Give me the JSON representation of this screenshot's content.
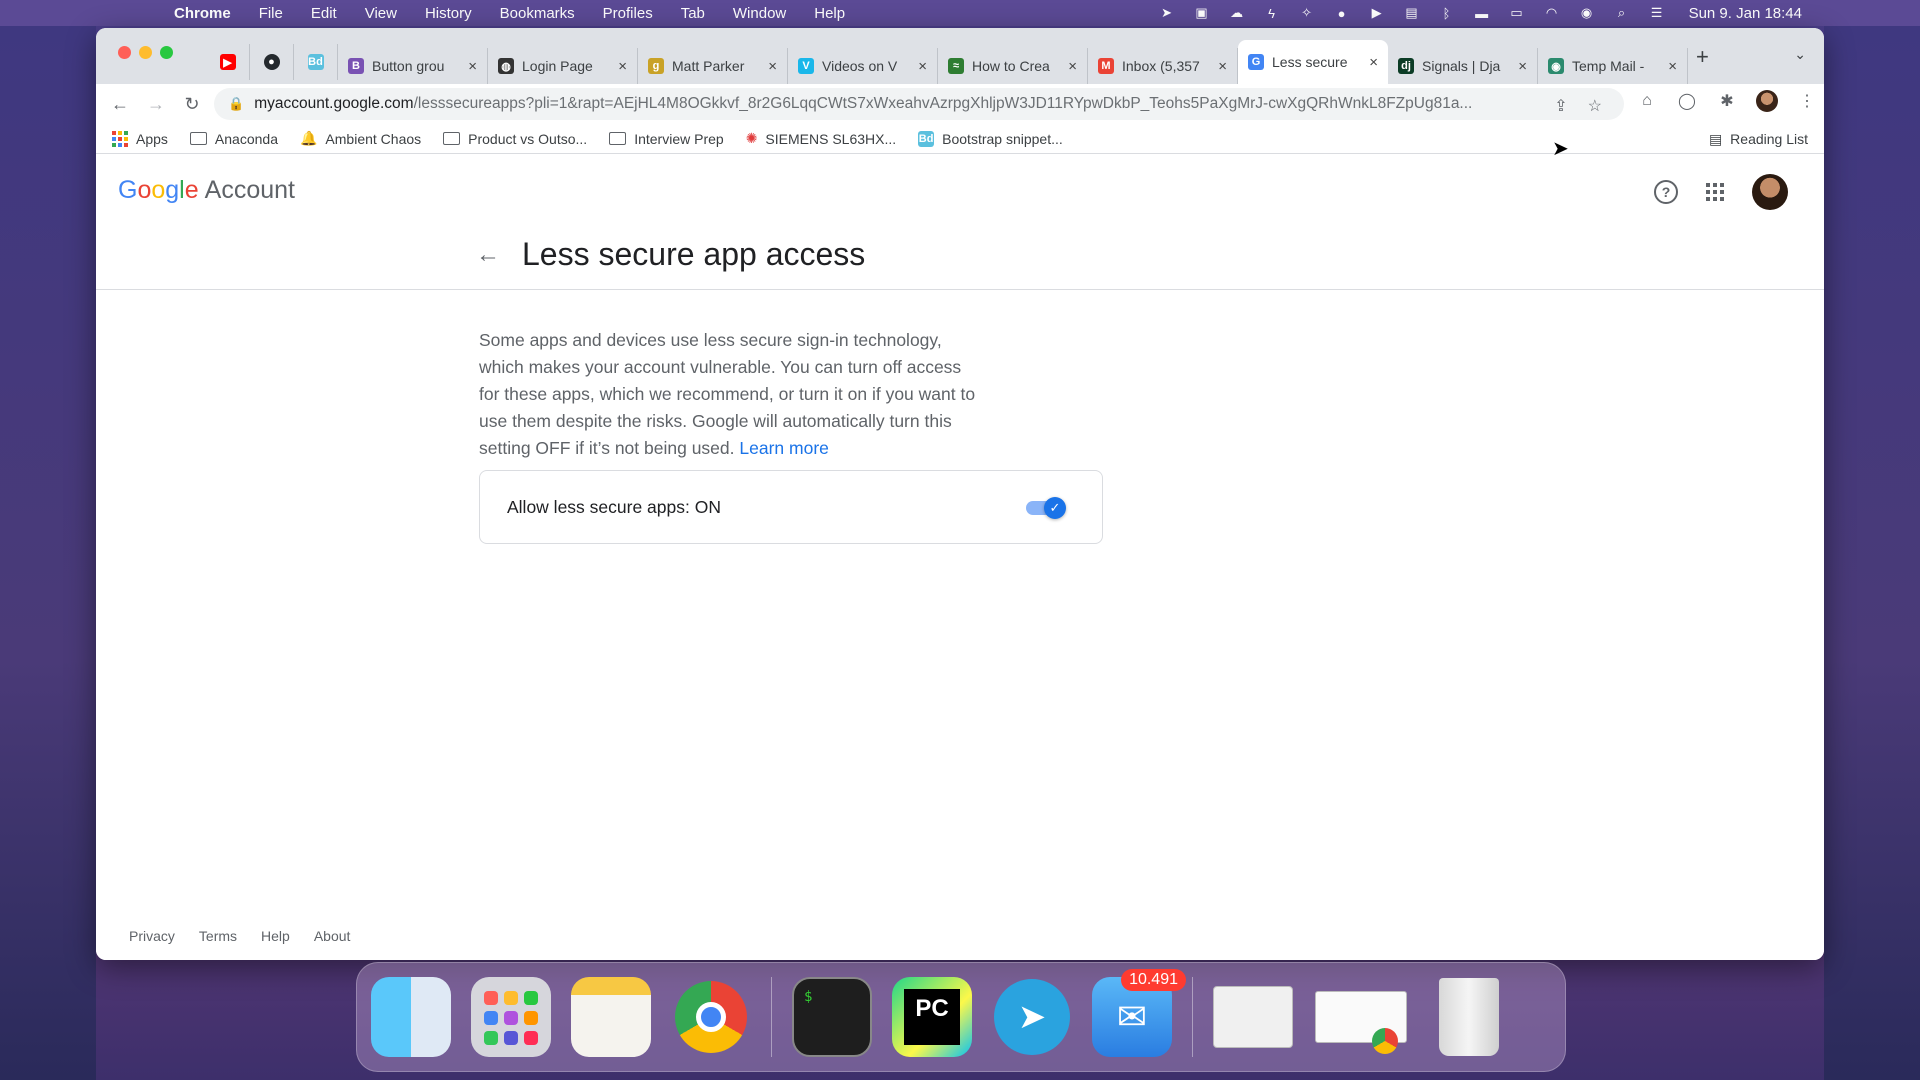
{
  "menubar": {
    "app": "Chrome",
    "items": [
      "File",
      "Edit",
      "View",
      "History",
      "Bookmarks",
      "Profiles",
      "Tab",
      "Window",
      "Help"
    ],
    "clock": "Sun 9. Jan  18:44"
  },
  "tabs": [
    {
      "label": "Button grou",
      "favicon": "B",
      "color": "#7952b3"
    },
    {
      "label": "Login Page",
      "favicon": "◍",
      "color": "#333333"
    },
    {
      "label": "Matt Parker",
      "favicon": "g",
      "color": "#c9a227"
    },
    {
      "label": "Videos on V",
      "favicon": "V",
      "color": "#1ab7ea"
    },
    {
      "label": "How to Crea",
      "favicon": "≈",
      "color": "#2e7d32"
    },
    {
      "label": "Inbox (5,357",
      "favicon": "M",
      "color": "#ea4335"
    },
    {
      "label": "Less secure",
      "favicon": "G",
      "color": "#4285f4",
      "active": true
    },
    {
      "label": "Signals | Dja",
      "favicon": "dj",
      "color": "#0c3c26"
    },
    {
      "label": "Temp Mail -",
      "favicon": "◉",
      "color": "#2b8a6e"
    }
  ],
  "omnibox": {
    "host": "myaccount.google.com",
    "rest": "/lesssecureapps?pli=1&rapt=AEjHL4M8OGkkvf_8r2G6LqqCWtS7xWxeahvAzrpgXhljpW3JD11RYpwDkbP_Teohs5PaXgMrJ-cwXgQRhWnkL8FZpUg81a..."
  },
  "bookmarks": [
    {
      "label": "Apps",
      "icon": "apps-icon"
    },
    {
      "label": "Anaconda",
      "icon": "folder-icon"
    },
    {
      "label": "Ambient Chaos",
      "icon": "bell-icon"
    },
    {
      "label": "Product vs Outso...",
      "icon": "folder-icon"
    },
    {
      "label": "Interview Prep",
      "icon": "folder-icon"
    },
    {
      "label": "SIEMENS SL63HX...",
      "icon": "siemens-icon"
    },
    {
      "label": "Bootstrap snippet...",
      "icon": "bootstrap-icon"
    }
  ],
  "reading_list": "Reading List",
  "header": {
    "logo_google": [
      "G",
      "o",
      "o",
      "g",
      "l",
      "e"
    ],
    "logo_account": "Account"
  },
  "page": {
    "title": "Less secure app access",
    "description": "Some apps and devices use less secure sign-in technology, which makes your account vulnerable. You can turn off access for these apps, which we recommend, or turn it on if you want to use them despite the risks. Google will automatically turn this setting OFF if it’s not being used.",
    "learn_more": "Learn more",
    "setting_label": "Allow less secure apps: ON",
    "toggle_state": "on"
  },
  "footer": {
    "links": [
      "Privacy",
      "Terms",
      "Help",
      "About"
    ]
  },
  "dock": {
    "terminal_text": "$",
    "pycharm_text": "PC",
    "mail_badge": "10.491"
  },
  "colors": {
    "accent": "#1a73e8",
    "toggle_track": "#8ab4f8"
  }
}
